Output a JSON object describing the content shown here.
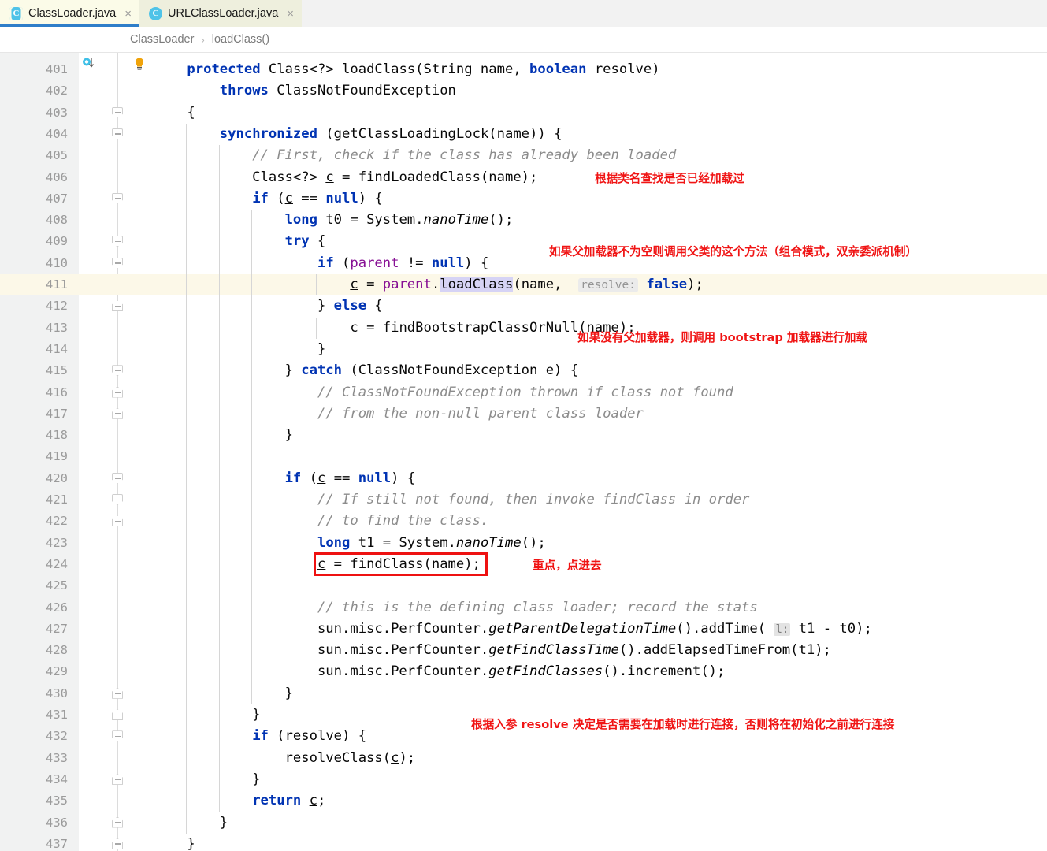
{
  "window": {
    "accent_blue": "#2f7ec9",
    "annotation_red": "#f01414",
    "keyword_blue": "#0033b3",
    "field_purple": "#871094",
    "comment_gray": "#8c8c8c"
  },
  "tabs": [
    {
      "label": "ClassLoader.java",
      "icon": "java-class-icon",
      "close": "×",
      "icon_letter": "C",
      "active": true
    },
    {
      "label": "URLClassLoader.java",
      "icon": "java-class-icon",
      "close": "×",
      "icon_letter": "C",
      "active": false
    }
  ],
  "breadcrumb": {
    "items": [
      "ClassLoader",
      "loadClass()"
    ],
    "separator": "›"
  },
  "editor": {
    "first_line": 401,
    "highlighted_line": 411,
    "gutter_icons": {
      "override_marker_line": 401,
      "intention_bulb_line": 411
    },
    "lines": [
      {
        "n": 401,
        "text": "    protected Class<?> loadClass(String name, boolean resolve)"
      },
      {
        "n": 402,
        "text": "        throws ClassNotFoundException"
      },
      {
        "n": 403,
        "text": "    {"
      },
      {
        "n": 404,
        "text": "        synchronized (getClassLoadingLock(name)) {"
      },
      {
        "n": 405,
        "text": "            // First, check if the class has already been loaded"
      },
      {
        "n": 406,
        "text": "            Class<?> c = findLoadedClass(name);"
      },
      {
        "n": 407,
        "text": "            if (c == null) {"
      },
      {
        "n": 408,
        "text": "                long t0 = System.nanoTime();"
      },
      {
        "n": 409,
        "text": "                try {"
      },
      {
        "n": 410,
        "text": "                    if (parent != null) {"
      },
      {
        "n": 411,
        "text": "                        c = parent.loadClass(name,  resolve: false);"
      },
      {
        "n": 412,
        "text": "                    } else {"
      },
      {
        "n": 413,
        "text": "                        c = findBootstrapClassOrNull(name);"
      },
      {
        "n": 414,
        "text": "                    }"
      },
      {
        "n": 415,
        "text": "                } catch (ClassNotFoundException e) {"
      },
      {
        "n": 416,
        "text": "                    // ClassNotFoundException thrown if class not found"
      },
      {
        "n": 417,
        "text": "                    // from the non-null parent class loader"
      },
      {
        "n": 418,
        "text": "                }"
      },
      {
        "n": 419,
        "text": ""
      },
      {
        "n": 420,
        "text": "                if (c == null) {"
      },
      {
        "n": 421,
        "text": "                    // If still not found, then invoke findClass in order"
      },
      {
        "n": 422,
        "text": "                    // to find the class."
      },
      {
        "n": 423,
        "text": "                    long t1 = System.nanoTime();"
      },
      {
        "n": 424,
        "text": "                    c = findClass(name);"
      },
      {
        "n": 425,
        "text": ""
      },
      {
        "n": 426,
        "text": "                    // this is the defining class loader; record the stats"
      },
      {
        "n": 427,
        "text": "                    sun.misc.PerfCounter.getParentDelegationTime().addTime( l: t1 - t0);"
      },
      {
        "n": 428,
        "text": "                    sun.misc.PerfCounter.getFindClassTime().addElapsedTimeFrom(t1);"
      },
      {
        "n": 429,
        "text": "                    sun.misc.PerfCounter.getFindClasses().increment();"
      },
      {
        "n": 430,
        "text": "                }"
      },
      {
        "n": 431,
        "text": "            }"
      },
      {
        "n": 432,
        "text": "            if (resolve) {"
      },
      {
        "n": 433,
        "text": "                resolveClass(c);"
      },
      {
        "n": 434,
        "text": "            }"
      },
      {
        "n": 435,
        "text": "            return c;"
      },
      {
        "n": 436,
        "text": "        }"
      },
      {
        "n": 437,
        "text": "    }"
      }
    ],
    "param_hints": [
      {
        "line": 411,
        "label": "resolve:"
      },
      {
        "line": 427,
        "label": "l:"
      }
    ]
  },
  "annotations": [
    {
      "id": "annot-find-loaded-class",
      "text": "根据类名查找是否已经加载过",
      "line": 406
    },
    {
      "id": "annot-parent-delegate",
      "text": "如果父加载器不为空则调用父类的这个方法（组合模式，双亲委派机制）",
      "line": 410
    },
    {
      "id": "annot-bootstrap",
      "text": "如果没有父加载器，则调用 bootstrap 加载器进行加载",
      "line": 414
    },
    {
      "id": "annot-findclass-focus",
      "text": "重点，点进去",
      "line": 424
    },
    {
      "id": "annot-resolve",
      "text": "根据入参 resolve 决定是否需要在加载时进行连接，否则将在初始化之前进行连接",
      "line": 432
    }
  ],
  "highlight_box": {
    "target_line": 424,
    "target_text": "c = findClass(name);",
    "color": "#ee1111"
  }
}
